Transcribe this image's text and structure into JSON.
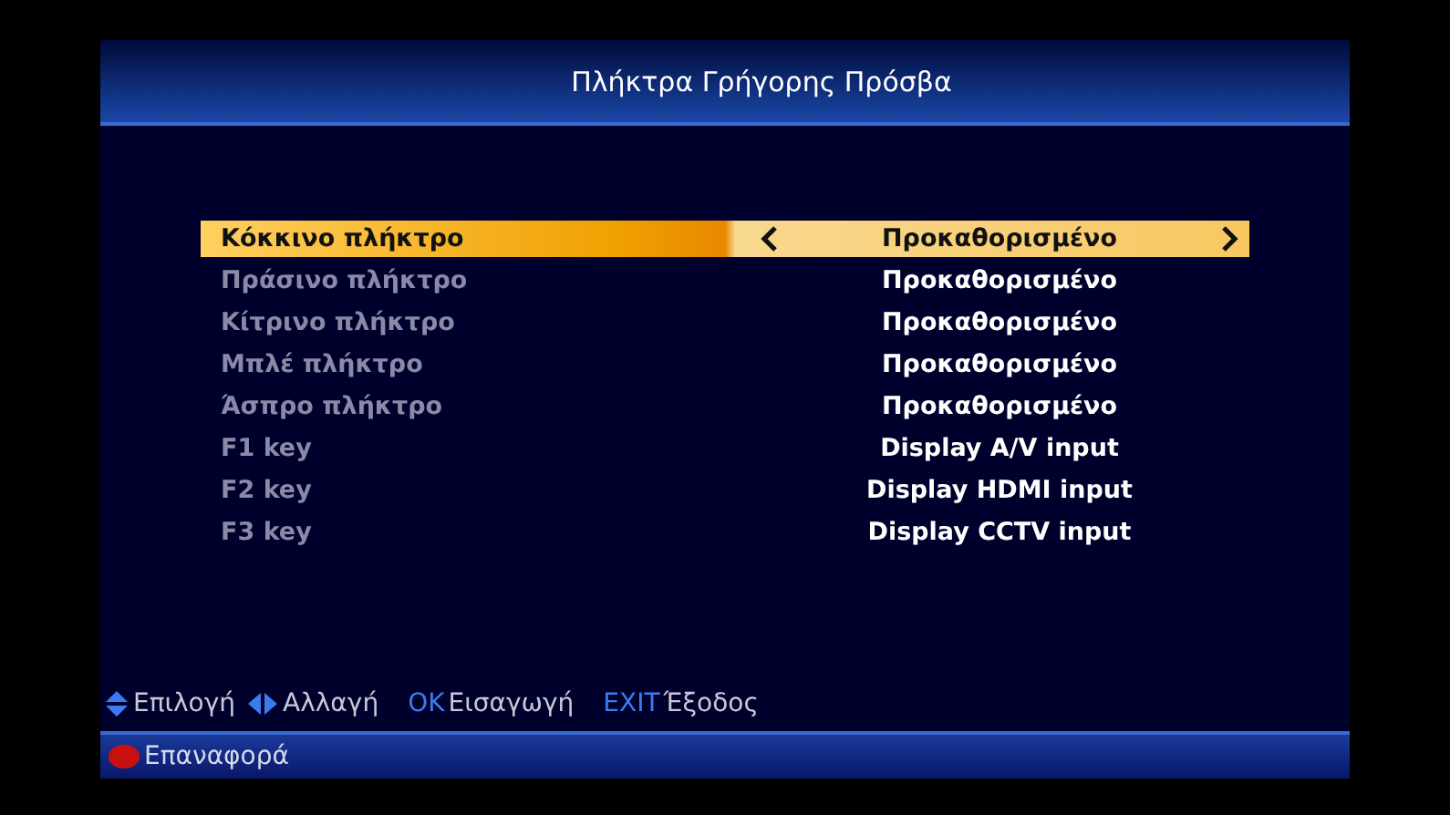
{
  "title": "Πλήκτρα Γρήγορης Πρόσβα",
  "rows": [
    {
      "label": "Κόκκινο πλήκτρο",
      "value": "Προκαθορισμένο",
      "selected": true
    },
    {
      "label": "Πράσινο πλήκτρο",
      "value": "Προκαθορισμένο",
      "selected": false
    },
    {
      "label": "Κίτρινο πλήκτρο",
      "value": "Προκαθορισμένο",
      "selected": false
    },
    {
      "label": "Μπλέ πλήκτρο",
      "value": "Προκαθορισμένο",
      "selected": false
    },
    {
      "label": "Άσπρο πλήκτρο",
      "value": "Προκαθορισμένο",
      "selected": false
    },
    {
      "label": "F1 key",
      "value": "Display A/V input",
      "selected": false
    },
    {
      "label": "F2 key",
      "value": "Display HDMI input",
      "selected": false
    },
    {
      "label": "F3 key",
      "value": "Display CCTV input",
      "selected": false
    }
  ],
  "hints": [
    {
      "kind": "updown",
      "text": "Επιλογή"
    },
    {
      "kind": "leftright",
      "text": "Αλλαγή"
    },
    {
      "kind": "key",
      "key": "OK",
      "text": "Εισαγωγή"
    },
    {
      "kind": "key",
      "key": "EXIT",
      "text": "Έξοδος"
    }
  ],
  "footer": {
    "text": "Επαναφορά"
  }
}
